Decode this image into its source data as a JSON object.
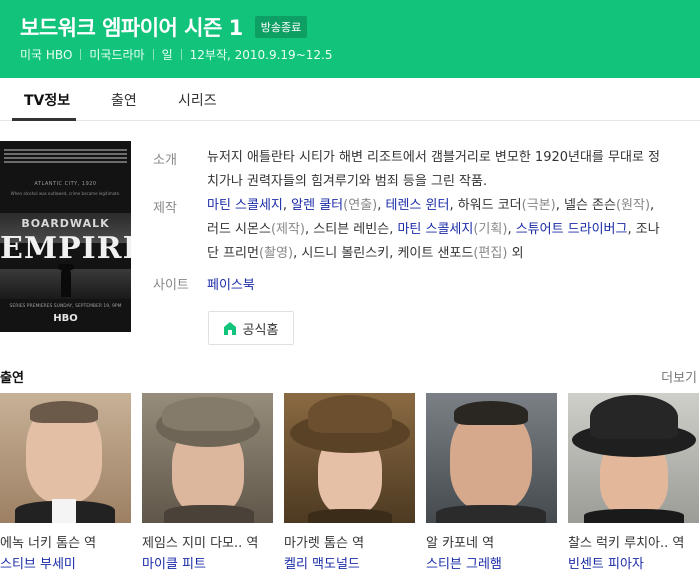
{
  "header": {
    "title": "보드워크 엠파이어 시즌 1",
    "badge": "방송종료",
    "meta": [
      "미국 HBO",
      "미국드라마",
      "일",
      "12부작, 2010.9.19~12.5"
    ],
    "bg_color": "#12c37b"
  },
  "tabs": [
    {
      "label": "TV정보",
      "active": true
    },
    {
      "label": "출연",
      "active": false
    },
    {
      "label": "시리즈",
      "active": false
    }
  ],
  "poster": {
    "city": "ATLANTIC CITY, 1920",
    "quote": "When alcohol was outlawed, crime became legitimate.",
    "boardwalk": "BOARDWALK",
    "empire": "EMPIRE",
    "premiere": "SERIES PREMIERES SUNDAY, SEPTEMBER 19, 9PM",
    "network": "HBO"
  },
  "info": {
    "intro_label": "소개",
    "intro_text": "뉴저지 애틀란타 시티가 해변 리조트에서 갬블거리로 변모한 1920년대를 무대로 정치가나 권력자들의 힘겨루기와 범죄 등을 그린 작품.",
    "production_label": "제작",
    "production": [
      {
        "name": "마틴 스콜세지",
        "link": true,
        "sep": ", "
      },
      {
        "name": "알렌 쿨터",
        "link": true,
        "role": "(연출)",
        "sep": ", "
      },
      {
        "name": "테렌스 윈터",
        "link": true,
        "sep": ", "
      },
      {
        "name": "하워드 코더",
        "link": false,
        "role": "(극본)",
        "sep": ", "
      },
      {
        "name": "넬슨 존슨",
        "link": false,
        "role": "(원작)",
        "sep": ", "
      },
      {
        "name": "러드 시몬스",
        "link": false,
        "role": "(제작)",
        "sep": ", "
      },
      {
        "name": "스티븐 레빈슨",
        "link": false,
        "sep": ", "
      },
      {
        "name": "마틴 스콜세지",
        "link": true,
        "role": "(기획)",
        "sep": ", "
      },
      {
        "name": "스튜어트 드라이버그",
        "link": true,
        "sep": ", "
      },
      {
        "name": "조나단 프리먼",
        "link": false,
        "role": "(촬영)",
        "sep": ", "
      },
      {
        "name": "시드니 볼린스키",
        "link": false,
        "sep": ", "
      },
      {
        "name": "케이트 샌포드",
        "link": false,
        "role": "(편집)",
        "sep": " "
      }
    ],
    "production_suffix": "외",
    "site_label": "사이트",
    "site_link": "페이스북",
    "official_button": "공식홈"
  },
  "cast_section": {
    "title": "출연",
    "more": "더보기",
    "items": [
      {
        "role": "에녹 너키 톰슨 역",
        "actor": "스티브 부세미"
      },
      {
        "role": "제임스 지미 다모.. 역",
        "actor": "마이클 피트"
      },
      {
        "role": "마가렛 톰슨 역",
        "actor": "켈리 맥도널드"
      },
      {
        "role": "알 카포네 역",
        "actor": "스티븐 그레햄"
      },
      {
        "role": "찰스 럭키 루치아.. 역",
        "actor": "빈센트 피아자"
      }
    ]
  },
  "colors": {
    "accent": "#12c37b",
    "link": "#1b2ca8",
    "label": "#888888"
  },
  "icons": {
    "official_home": "home-icon"
  }
}
